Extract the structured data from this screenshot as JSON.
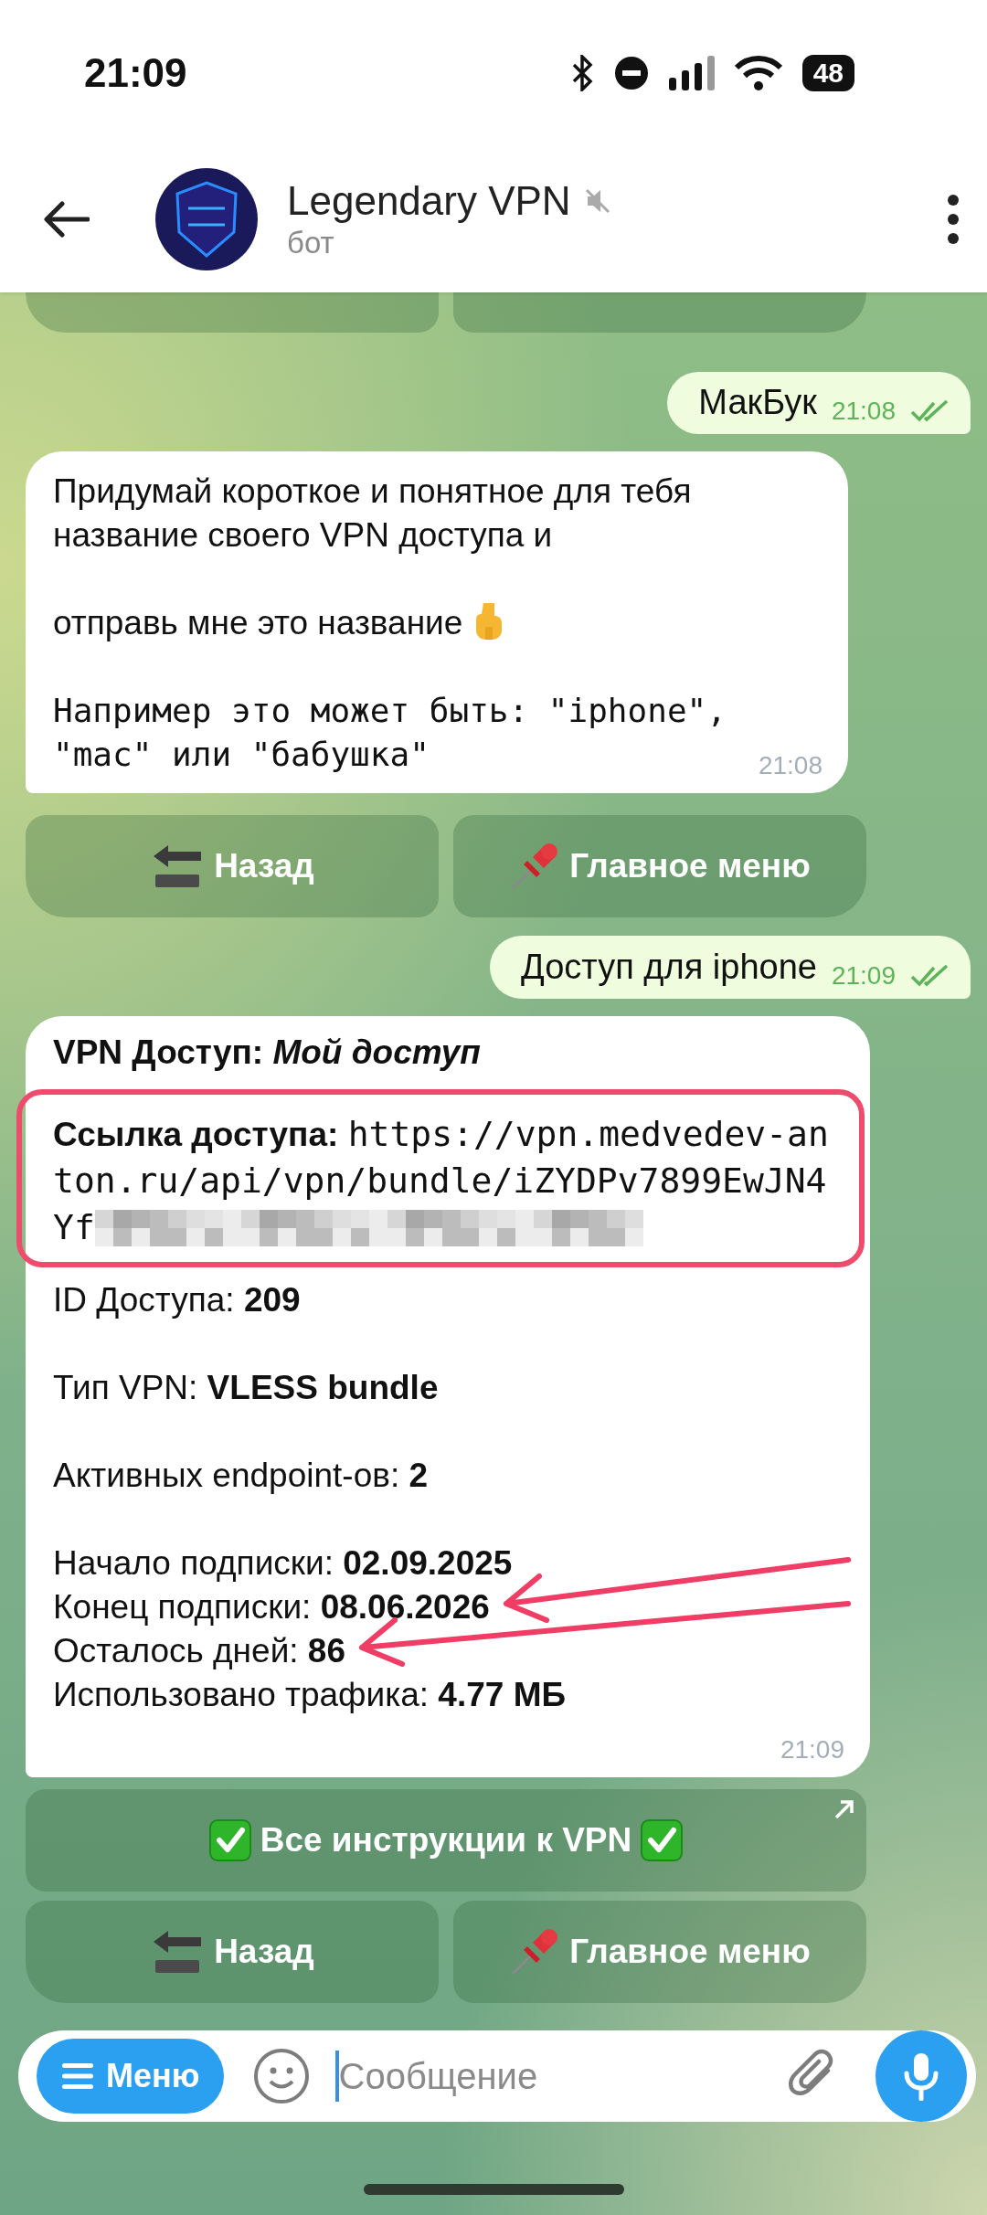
{
  "status_bar": {
    "time": "21:09",
    "battery": "48"
  },
  "header": {
    "title": "Legendary VPN",
    "subtitle": "бот",
    "muted": true
  },
  "messages": [
    {
      "kind": "keyboard_edge",
      "rows": [
        [
          {
            "kind": "back"
          },
          {
            "kind": "menu"
          }
        ]
      ]
    },
    {
      "kind": "outgoing",
      "text": "МакБук",
      "time": "21:08",
      "read": true
    },
    {
      "kind": "incoming",
      "time": "21:08",
      "paragraphs": [
        {
          "kind": "text",
          "text": "Придумай короткое и понятное для тебя название своего VPN доступа и"
        },
        {
          "kind": "text_pointing_down",
          "text": "отправь мне это название"
        },
        {
          "kind": "code",
          "text": "Например это может быть: \"iphone\", \"mac\" или \"бабушка\""
        }
      ]
    },
    {
      "kind": "keyboard",
      "rows": [
        [
          {
            "label": "Назад",
            "kind": "back"
          },
          {
            "label": "Главное меню",
            "kind": "menu"
          }
        ]
      ]
    },
    {
      "kind": "outgoing",
      "text": "Доступ для iphone",
      "time": "21:09",
      "read": true
    },
    {
      "kind": "access_card",
      "time": "21:09",
      "title": "VPN Доступ: *Мой доступ*",
      "link": {
        "label": "Ссылка доступа:",
        "value": "https://vpn.medvedev-anton.ru/api/vpn/bundle/iZYDPv7899EwJN4Yf",
        "redacted": true,
        "highlighted": true
      },
      "groups": [
        [
          {
            "text": "ID Доступа: **209**",
            "pointed": false
          }
        ],
        [
          {
            "text": "Тип VPN: **VLESS bundle**",
            "pointed": false
          }
        ],
        [
          {
            "text": "Активных endpoint-ов: **2**",
            "pointed": false
          }
        ],
        [
          {
            "text": "Начало подписки: **02.09.2025**",
            "pointed": false
          },
          {
            "text": "Конец подписки: **08.06.2026**",
            "pointed": true
          },
          {
            "text": "Осталось дней: **86**",
            "pointed": true
          },
          {
            "text": "Использовано трафика: **4.77 МБ**",
            "pointed": false
          }
        ]
      ]
    },
    {
      "kind": "keyboard",
      "rows": [
        [
          {
            "label": "Все инструкции к VPN",
            "kind": "instructions",
            "external": true
          }
        ],
        [
          {
            "label": "Назад",
            "kind": "back"
          },
          {
            "label": "Главное меню",
            "kind": "menu"
          }
        ]
      ]
    }
  ],
  "composer": {
    "menu_label": "Меню",
    "placeholder": "Сообщение"
  }
}
